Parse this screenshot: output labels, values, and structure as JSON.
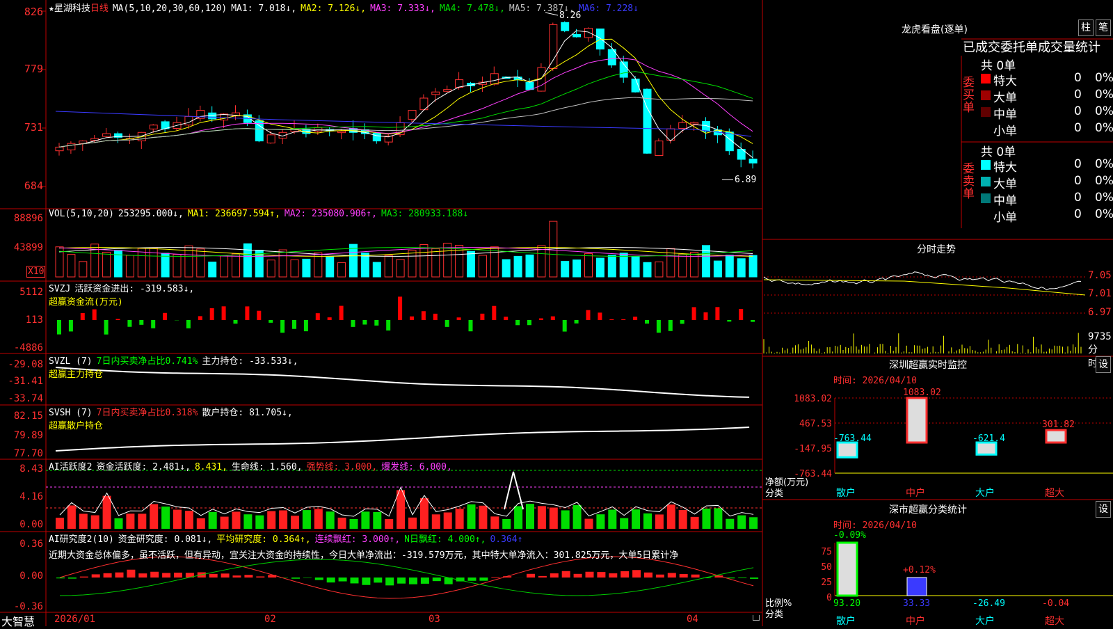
{
  "stock": {
    "name": "星湖科技",
    "period": "日线",
    "star": "★"
  },
  "left_axis": {
    "price": [
      "826",
      "779",
      "731",
      "684"
    ],
    "vol": [
      "88896",
      "43899"
    ],
    "vol_unit": "X10",
    "flow": [
      "5112",
      "113",
      "-4886"
    ],
    "svzl": [
      "-29.08",
      "-31.41",
      "-33.74"
    ],
    "svsh": [
      "82.15",
      "79.89",
      "77.70"
    ],
    "ai1": [
      "8.43",
      "4.16",
      "0.00"
    ],
    "ai2": [
      "0.36",
      "0.00",
      "-0.36"
    ]
  },
  "price_header": [
    {
      "text": "MA(5,10,20,30,60,120)",
      "color": "#ffffff"
    },
    {
      "text": "MA1: 7.018↓,",
      "color": "#ffffff"
    },
    {
      "text": "MA2: 7.126↓,",
      "color": "#ffff00"
    },
    {
      "text": "MA3: 7.333↓,",
      "color": "#ff40ff"
    },
    {
      "text": "MA4: 7.478↓,",
      "color": "#00e000"
    },
    {
      "text": "MA5: 7.387↓,",
      "color": "#c0c0c0"
    },
    {
      "text": "MA6: 7.228↓",
      "color": "#3a3aff"
    }
  ],
  "price_marks": {
    "high": "8.26",
    "low": "6.89"
  },
  "vol_header": [
    {
      "text": "VOL(5,10,20)",
      "color": "#ffffff"
    },
    {
      "text": "253295.000↓,",
      "color": "#ffffff"
    },
    {
      "text": "MA1: 236697.594↑,",
      "color": "#ffff00"
    },
    {
      "text": "MA2: 235080.906↑,",
      "color": "#ff40ff"
    },
    {
      "text": "MA3: 280933.188↓",
      "color": "#00e000"
    }
  ],
  "flow_header": [
    {
      "text": "SVZJ",
      "color": "#ffffff"
    },
    {
      "text": "活跃资金进出: -319.583↓,",
      "color": "#ffffff"
    }
  ],
  "flow_sub": "超赢资金流(万元)",
  "svzl_header": [
    {
      "text": "SVZL (7)",
      "color": "#ffffff"
    },
    {
      "text": "7日内买卖净占比0.741%",
      "color": "#00ff00"
    },
    {
      "text": "主力持仓: -33.533↓,",
      "color": "#ffffff"
    }
  ],
  "svzl_sub": "超赢主力持仓",
  "svsh_header": [
    {
      "text": "SVSH (7)",
      "color": "#ffffff"
    },
    {
      "text": "7日内买卖净占比0.318%",
      "color": "#ff3030"
    },
    {
      "text": "散户持仓: 81.705↓,",
      "color": "#ffffff"
    }
  ],
  "svsh_sub": "超赢散户持仓",
  "ai1_header": [
    {
      "text": "AI活跃度2",
      "color": "#ffffff"
    },
    {
      "text": "资金活跃度: 2.481↓,",
      "color": "#ffffff"
    },
    {
      "text": "8.431,",
      "color": "#ffff00"
    },
    {
      "text": "生命线: 1.560,",
      "color": "#ffffff"
    },
    {
      "text": "强势线: 3.000,",
      "color": "#ff3030"
    },
    {
      "text": "爆发线: 6.000,",
      "color": "#ff40ff"
    }
  ],
  "ai2_header": [
    {
      "text": "AI研究度2(10)",
      "color": "#ffffff"
    },
    {
      "text": "资金研究度: 0.081↓,",
      "color": "#ffffff"
    },
    {
      "text": "平均研究度: 0.364↑,",
      "color": "#ffff00"
    },
    {
      "text": "连续飘红: 3.000↑,",
      "color": "#ff40ff"
    },
    {
      "text": "N日飘红: 4.000↑,",
      "color": "#00ff00"
    },
    {
      "text": "0.364↑",
      "color": "#3a3aff"
    }
  ],
  "ai2_note": "近期大资金总体偏多，虽不活跃，但有异动，宜关注大资金的持续性，今日大单净流出：-319.579万元，其中特大单净流入：301.825万元，大单5日累计净",
  "dates": [
    "2026/01",
    "02",
    "03",
    "04"
  ],
  "brand": "大智慧",
  "right": {
    "lhb_title": "龙虎看盘(逐单)",
    "btn_bar": "柱",
    "btn_pen": "笔",
    "lhb_tabs": "已成交委托单成交量统计",
    "buy": {
      "side": "委买单",
      "total": "共 0单",
      "rows": [
        {
          "label": "特大",
          "count": "0",
          "pct": "0%",
          "color": "#ff0000"
        },
        {
          "label": "大单",
          "count": "0",
          "pct": "0%",
          "color": "#a00000"
        },
        {
          "label": "中单",
          "count": "0",
          "pct": "0%",
          "color": "#600000"
        },
        {
          "label": "小单",
          "count": "0",
          "pct": "0%",
          "color": ""
        }
      ]
    },
    "sell": {
      "side": "委卖单",
      "total": "共 0单",
      "rows": [
        {
          "label": "特大",
          "count": "0",
          "pct": "0%",
          "color": "#00ffff"
        },
        {
          "label": "大单",
          "count": "0",
          "pct": "0%",
          "color": "#00b0b0"
        },
        {
          "label": "中单",
          "count": "0",
          "pct": "0%",
          "color": "#007878"
        },
        {
          "label": "小单",
          "count": "0",
          "pct": "0%",
          "color": ""
        }
      ]
    },
    "intraday": {
      "title": "分时走势",
      "axis": [
        "7.05",
        "7.01",
        "6.97"
      ],
      "vol_label": "9735",
      "vol_unit": "分时"
    },
    "monitor": {
      "title": "深圳超赢实时监控",
      "set": "设",
      "time": "时间: 2026/04/10",
      "axis": [
        "1083.02",
        "467.53",
        "-147.95",
        "-763.44"
      ],
      "ylabel": "净额(万元)",
      "xlabel": "分类",
      "cats": [
        "散户",
        "中户",
        "大户",
        "超大"
      ],
      "values": [
        -763.44,
        1083.02,
        -621.4,
        301.82
      ],
      "labels": [
        "-763.44",
        "1083.02",
        "-621.4",
        "301.82"
      ]
    },
    "classify": {
      "title": "深市超赢分类统计",
      "set": "设",
      "time": "时间: 2026/04/10",
      "axis": [
        "75",
        "50",
        "25",
        "0"
      ],
      "ylabel": "比例%",
      "xlabel": "分类",
      "cats": [
        "散户",
        "中户",
        "大户",
        "超大"
      ],
      "bar_labels": [
        "-0.09%",
        "+0.12%"
      ],
      "values": [
        "93.20",
        "33.33",
        "-26.49",
        "-0.04"
      ]
    }
  }
}
